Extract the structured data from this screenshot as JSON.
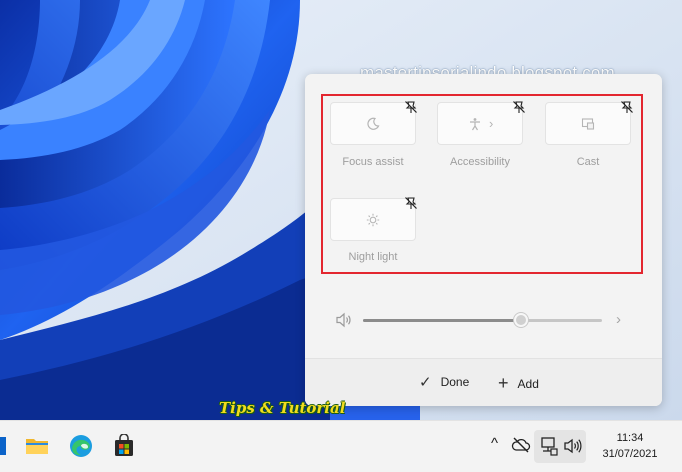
{
  "watermark": "mastertipsorialindo.blogspot.com",
  "quick_settings": {
    "tiles": [
      {
        "label": "Focus assist",
        "icon": "moon-icon"
      },
      {
        "label": "Accessibility",
        "icon": "accessibility-icon",
        "chevron": "›"
      },
      {
        "label": "Cast",
        "icon": "cast-icon"
      },
      {
        "label": "Night light",
        "icon": "brightness-icon"
      }
    ],
    "volume": {
      "level": 0.66,
      "more": "›"
    },
    "footer": {
      "done_label": "Done",
      "done_icon": "✓",
      "add_label": "Add",
      "add_icon": "+"
    }
  },
  "overlay_text": "Tips & Tutorial",
  "taskbar": {
    "tray": {
      "chevron": "^"
    },
    "clock": {
      "time": "11:34",
      "date": "31/07/2021"
    }
  },
  "colors": {
    "highlight": "#e3262f",
    "wallpaper_blue": "#1a56e0"
  }
}
